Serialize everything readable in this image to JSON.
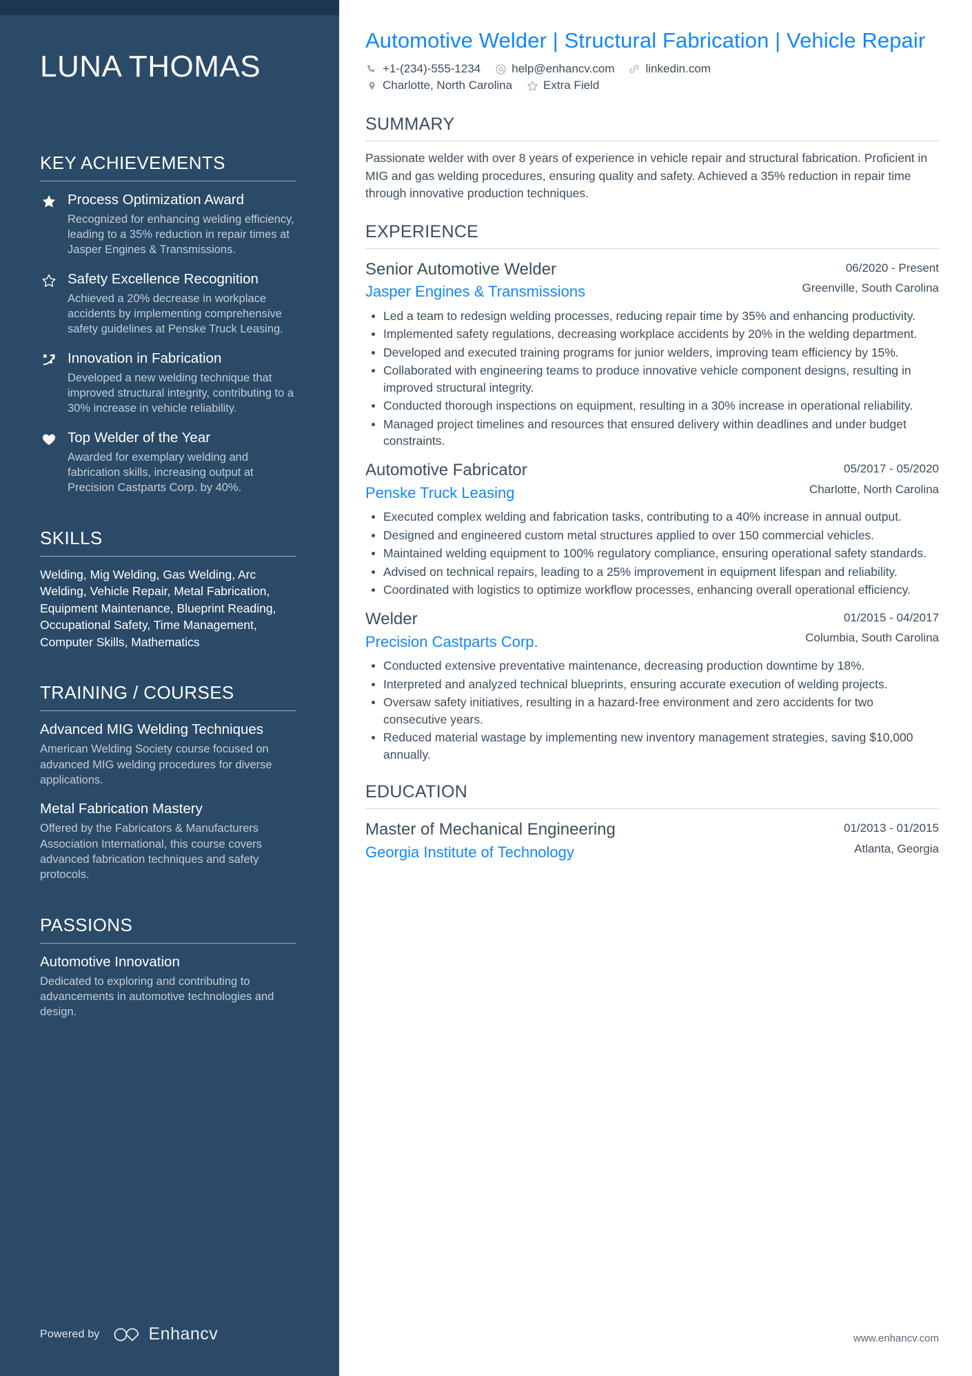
{
  "sidebar": {
    "name": "LUNA THOMAS",
    "sections": {
      "achievements_title": "KEY ACHIEVEMENTS",
      "skills_title": "SKILLS",
      "training_title": "TRAINING / COURSES",
      "passions_title": "PASSIONS"
    },
    "achievements": [
      {
        "icon": "star-filled-icon",
        "title": "Process Optimization Award",
        "text": "Recognized for enhancing welding efficiency, leading to a 35% reduction in repair times at Jasper Engines & Transmissions."
      },
      {
        "icon": "star-outline-icon",
        "title": "Safety Excellence Recognition",
        "text": "Achieved a 20% decrease in workplace accidents by implementing comprehensive safety guidelines at Penske Truck Leasing."
      },
      {
        "icon": "innovation-arrow-icon",
        "title": "Innovation in Fabrication",
        "text": "Developed a new welding technique that improved structural integrity, contributing to a 30% increase in vehicle reliability."
      },
      {
        "icon": "heart-filled-icon",
        "title": "Top Welder of the Year",
        "text": "Awarded for exemplary welding and fabrication skills, increasing output at Precision Castparts Corp. by 40%."
      }
    ],
    "skills_text": "Welding, Mig Welding, Gas Welding, Arc Welding, Vehicle Repair, Metal Fabrication, Equipment Maintenance, Blueprint Reading, Occupational Safety, Time Management, Computer Skills, Mathematics",
    "courses": [
      {
        "title": "Advanced MIG Welding Techniques",
        "text": "American Welding Society course focused on advanced MIG welding procedures for diverse applications."
      },
      {
        "title": "Metal Fabrication Mastery",
        "text": "Offered by the Fabricators & Manufacturers Association International, this course covers advanced fabrication techniques and safety protocols."
      }
    ],
    "passions": [
      {
        "title": "Automotive Innovation",
        "text": "Dedicated to exploring and contributing to advancements in automotive technologies and design."
      }
    ],
    "powered_by_label": "Powered by",
    "powered_by_brand": "Enhancv"
  },
  "main": {
    "headline": "Automotive Welder | Structural Fabrication | Vehicle Repair",
    "contacts_row1": [
      {
        "icon": "phone-icon",
        "text": "+1-(234)-555-1234"
      },
      {
        "icon": "at-email-icon",
        "text": "help@enhancv.com"
      },
      {
        "icon": "link-icon",
        "text": "linkedin.com"
      }
    ],
    "contacts_row2": [
      {
        "icon": "location-pin-icon",
        "text": "Charlotte, North Carolina"
      },
      {
        "icon": "star-outline-icon",
        "text": "Extra Field"
      }
    ],
    "summary_title": "SUMMARY",
    "summary_text": "Passionate welder with over 8 years of experience in vehicle repair and structural fabrication. Proficient in MIG and gas welding procedures, ensuring quality and safety. Achieved a 35% reduction in repair time through innovative production techniques.",
    "experience_title": "EXPERIENCE",
    "experience": [
      {
        "role": "Senior Automotive Welder",
        "org": "Jasper Engines & Transmissions",
        "date": "06/2020 - Present",
        "location": "Greenville, South Carolina",
        "bullets": [
          "Led a team to redesign welding processes, reducing repair time by 35% and enhancing productivity.",
          "Implemented safety regulations, decreasing workplace accidents by 20% in the welding department.",
          "Developed and executed training programs for junior welders, improving team efficiency by 15%.",
          "Collaborated with engineering teams to produce innovative vehicle component designs, resulting in improved structural integrity.",
          "Conducted thorough inspections on equipment, resulting in a 30% increase in operational reliability.",
          "Managed project timelines and resources that ensured delivery within deadlines and under budget constraints."
        ]
      },
      {
        "role": "Automotive Fabricator",
        "org": "Penske Truck Leasing",
        "date": "05/2017 - 05/2020",
        "location": "Charlotte, North Carolina",
        "bullets": [
          "Executed complex welding and fabrication tasks, contributing to a 40% increase in annual output.",
          "Designed and engineered custom metal structures applied to over 150 commercial vehicles.",
          "Maintained welding equipment to 100% regulatory compliance, ensuring operational safety standards.",
          "Advised on technical repairs, leading to a 25% improvement in equipment lifespan and reliability.",
          "Coordinated with logistics to optimize workflow processes, enhancing overall operational efficiency."
        ]
      },
      {
        "role": "Welder",
        "org": "Precision Castparts Corp.",
        "date": "01/2015 - 04/2017",
        "location": "Columbia, South Carolina",
        "bullets": [
          "Conducted extensive preventative maintenance, decreasing production downtime by 18%.",
          "Interpreted and analyzed technical blueprints, ensuring accurate execution of welding projects.",
          "Oversaw safety initiatives, resulting in a hazard-free environment and zero accidents for two consecutive years.",
          "Reduced material wastage by implementing new inventory management strategies, saving $10,000 annually."
        ]
      }
    ],
    "education_title": "EDUCATION",
    "education": [
      {
        "degree": "Master of Mechanical Engineering",
        "school": "Georgia Institute of Technology",
        "date": "01/2013 - 01/2015",
        "location": "Atlanta, Georgia"
      }
    ],
    "footer_url": "www.enhancv.com"
  },
  "colors": {
    "sidebar_bg": "#2a4a68",
    "sidebar_topbar": "#1d3650",
    "accent_blue": "#1287fb",
    "body_text": "#3d4d5c",
    "muted_text": "#c3ccd6"
  }
}
